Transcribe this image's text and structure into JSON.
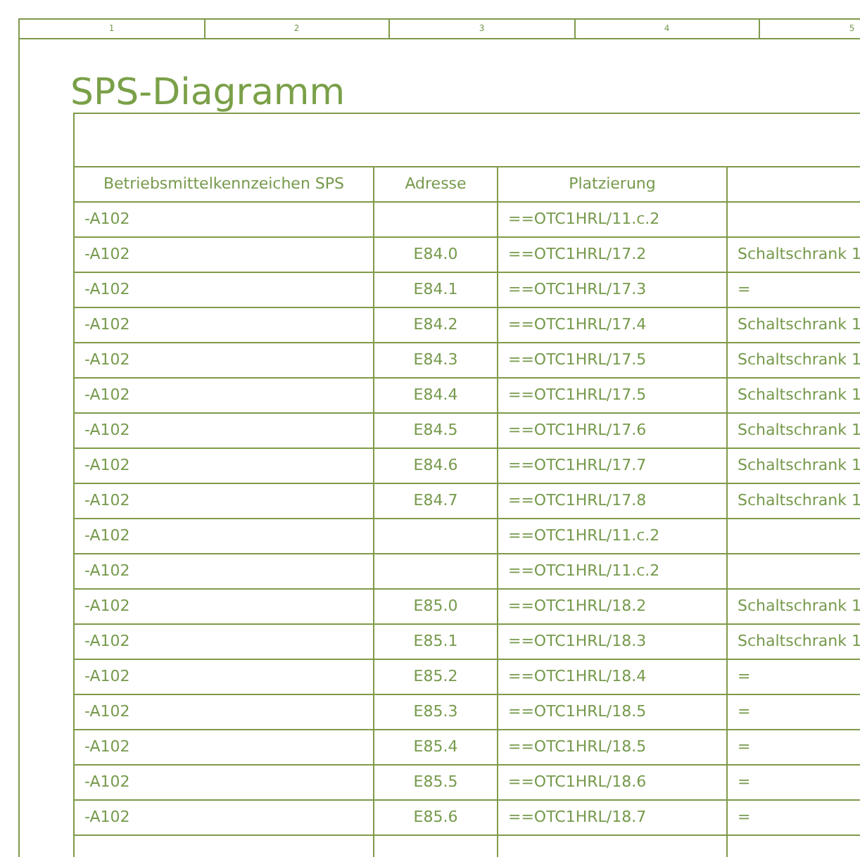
{
  "ruler": [
    "1",
    "2",
    "3",
    "4",
    "5"
  ],
  "title": "SPS-Diagramm",
  "table": {
    "columns": [
      "Betriebsmittelkennzeichen SPS",
      "Adresse",
      "Platzierung"
    ],
    "rows": [
      {
        "device_tag": "-A102",
        "placement": "==OTC1HRL/11.c.2"
      },
      {
        "device_tag": "-A102",
        "address": "E84.0",
        "placement": "==OTC1HRL/17.2",
        "column_4": "Schaltschrank 1"
      },
      {
        "device_tag": "-A102",
        "address": "E84.1",
        "placement": "==OTC1HRL/17.3",
        "column_4": "="
      },
      {
        "device_tag": "-A102",
        "address": "E84.2",
        "placement": "==OTC1HRL/17.4",
        "column_4": "Schaltschrank 1"
      },
      {
        "device_tag": "-A102",
        "address": "E84.3",
        "placement": "==OTC1HRL/17.5",
        "column_4": "Schaltschrank 1"
      },
      {
        "device_tag": "-A102",
        "address": "E84.4",
        "placement": "==OTC1HRL/17.5",
        "column_4": "Schaltschrank 1"
      },
      {
        "device_tag": "-A102",
        "address": "E84.5",
        "placement": "==OTC1HRL/17.6",
        "column_4": "Schaltschrank 1"
      },
      {
        "device_tag": "-A102",
        "address": "E84.6",
        "placement": "==OTC1HRL/17.7",
        "column_4": "Schaltschrank 1"
      },
      {
        "device_tag": "-A102",
        "address": "E84.7",
        "placement": "==OTC1HRL/17.8",
        "column_4": "Schaltschrank 1"
      },
      {
        "device_tag": "-A102",
        "placement": "==OTC1HRL/11.c.2"
      },
      {
        "device_tag": "-A102",
        "placement": "==OTC1HRL/11.c.2"
      },
      {
        "device_tag": "-A102",
        "address": "E85.0",
        "placement": "==OTC1HRL/18.2",
        "column_4": "Schaltschrank 1"
      },
      {
        "device_tag": "-A102",
        "address": "E85.1",
        "placement": "==OTC1HRL/18.3",
        "column_4": "Schaltschrank 1"
      },
      {
        "device_tag": "-A102",
        "address": "E85.2",
        "placement": "==OTC1HRL/18.4",
        "column_4": "="
      },
      {
        "device_tag": "-A102",
        "address": "E85.3",
        "placement": "==OTC1HRL/18.5",
        "column_4": "="
      },
      {
        "device_tag": "-A102",
        "address": "E85.4",
        "placement": "==OTC1HRL/18.5",
        "column_4": "="
      },
      {
        "device_tag": "-A102",
        "address": "E85.5",
        "placement": "==OTC1HRL/18.6",
        "column_4": "="
      },
      {
        "device_tag": "-A102",
        "address": "E85.6",
        "placement": "==OTC1HRL/18.7",
        "column_4": "="
      }
    ]
  }
}
